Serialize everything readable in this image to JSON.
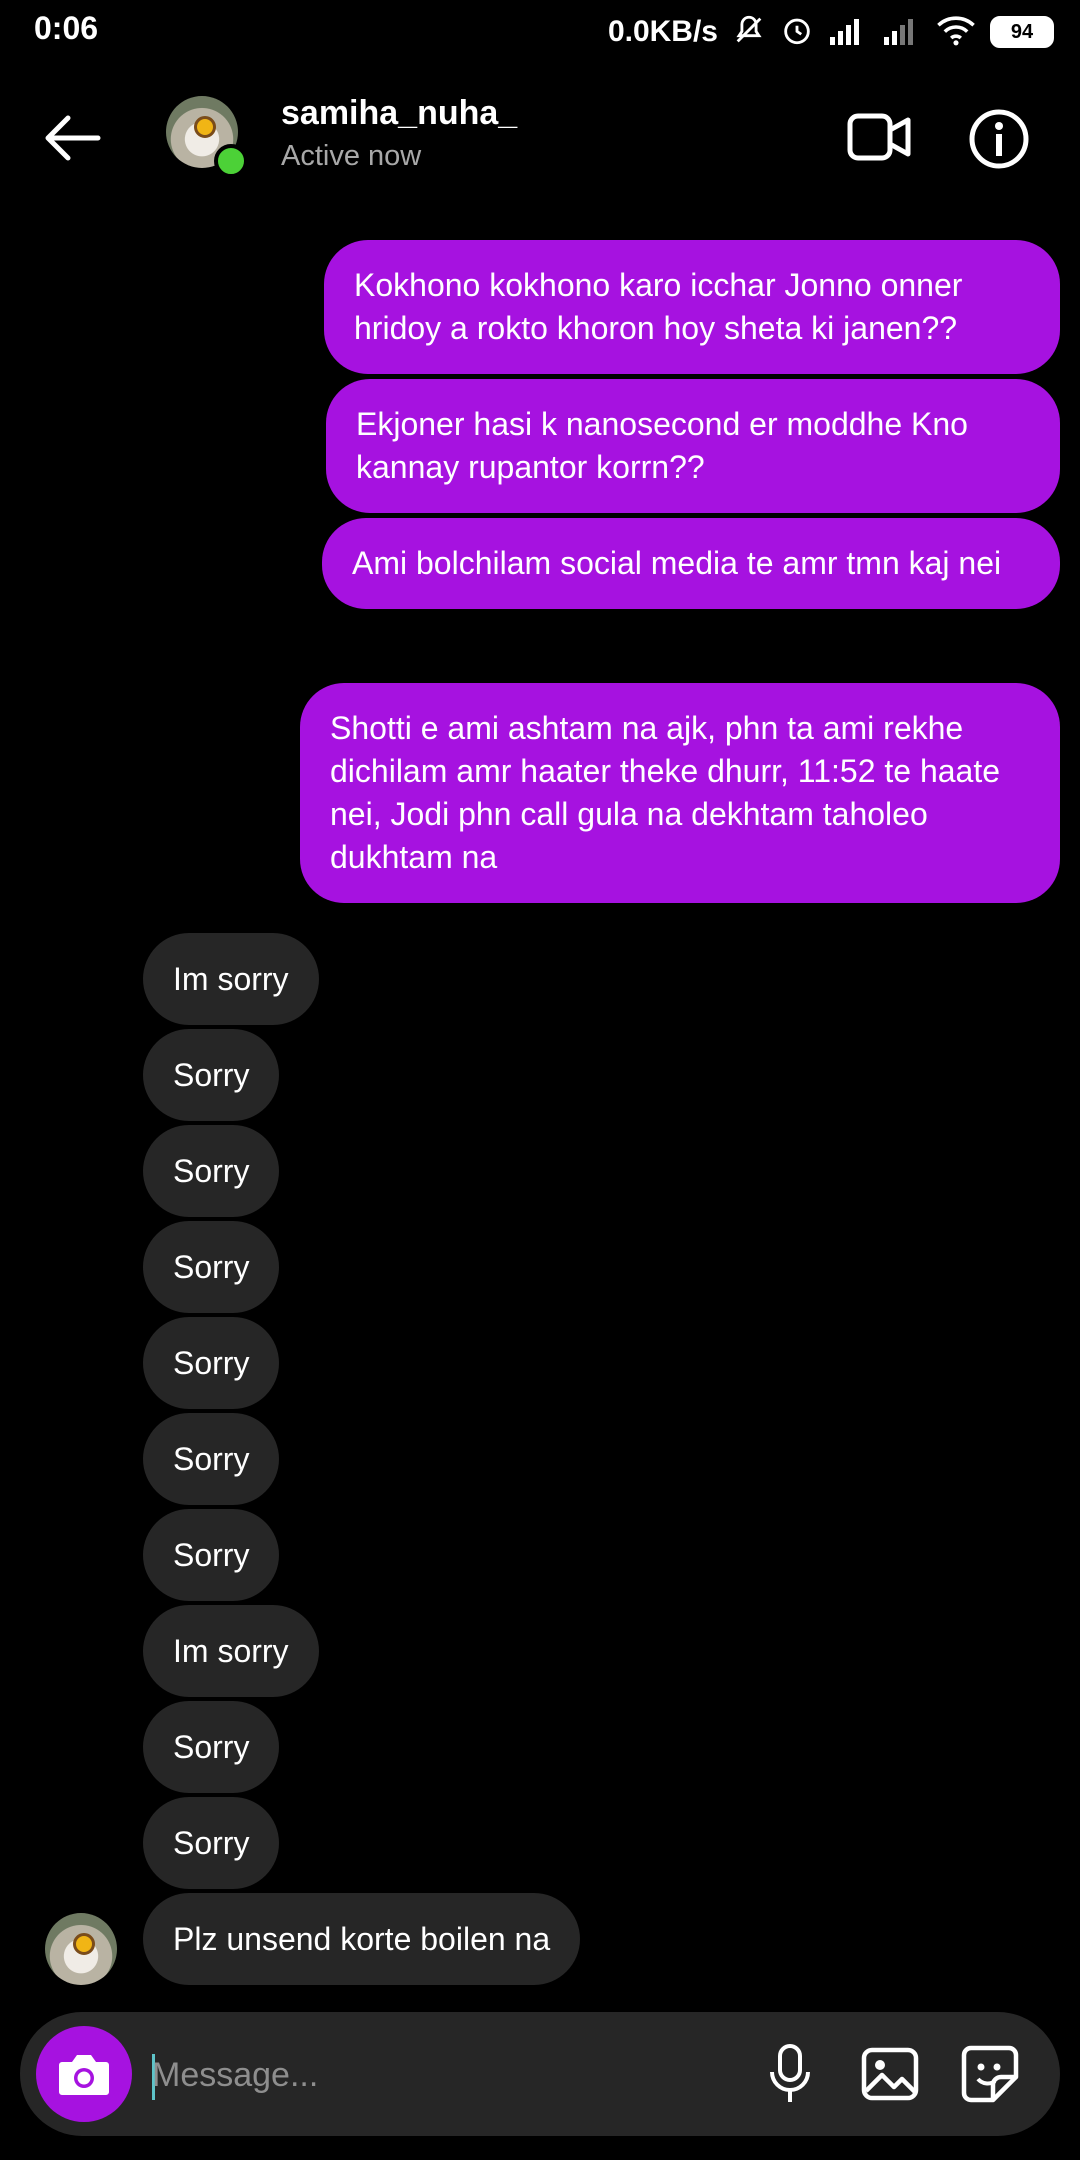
{
  "status_bar": {
    "time": "0:06",
    "net_speed": "0.0KB/s",
    "battery": "94"
  },
  "header": {
    "username": "samiha_nuha_",
    "status": "Active now"
  },
  "messages_out": [
    "Kokhono kokhono karo icchar Jonno onner hridoy a rokto khoron hoy sheta ki janen??",
    "Ekjoner hasi k nanosecond er moddhe Kno kannay rupantor korrn??",
    "Ami bolchilam social media te amr tmn kaj nei",
    "Shotti e ami ashtam na ajk, phn ta ami rekhe dichilam amr haater theke dhurr, 11:52 te haate nei, Jodi phn call gula na dekhtam taholeo dukhtam na"
  ],
  "messages_in": [
    "Im sorry",
    "Sorry",
    "Sorry",
    "Sorry",
    "Sorry",
    "Sorry",
    "Sorry",
    "Im sorry",
    "Sorry",
    "Sorry",
    "Plz unsend korte boilen na"
  ],
  "composer": {
    "placeholder": "Message..."
  },
  "colors": {
    "outgoing_bubble": "#a612e0",
    "incoming_bubble": "#262626",
    "online_dot": "#4cd137",
    "background": "#000000"
  },
  "icons": [
    "back-arrow-icon",
    "video-call-icon",
    "info-icon",
    "camera-icon",
    "microphone-icon",
    "gallery-icon",
    "sticker-icon",
    "wifi-icon",
    "signal-icon",
    "alarm-icon",
    "mute-icon"
  ]
}
